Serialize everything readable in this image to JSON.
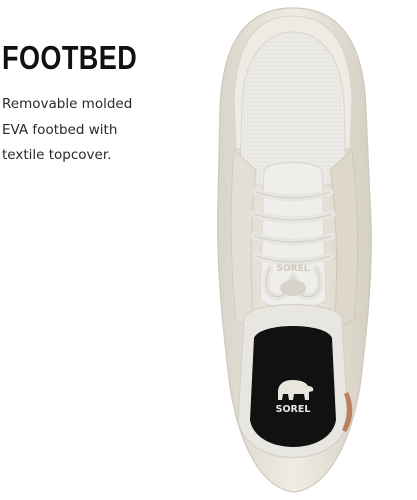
{
  "feature": {
    "title": "FOOTBED",
    "description_lines": [
      "Removable molded",
      "EVA footbed with",
      "textile topcover."
    ]
  },
  "product_image": {
    "tongue_logo_text": "SOREL",
    "insole_logo_text": "SOREL",
    "logo_icon": "polar-bear-icon"
  },
  "colors": {
    "upper": "#ece8df",
    "mesh": "#e9e8e3",
    "suede": "#ddd7cc",
    "insole": "#111111",
    "accent_heel": "#b9815d"
  }
}
